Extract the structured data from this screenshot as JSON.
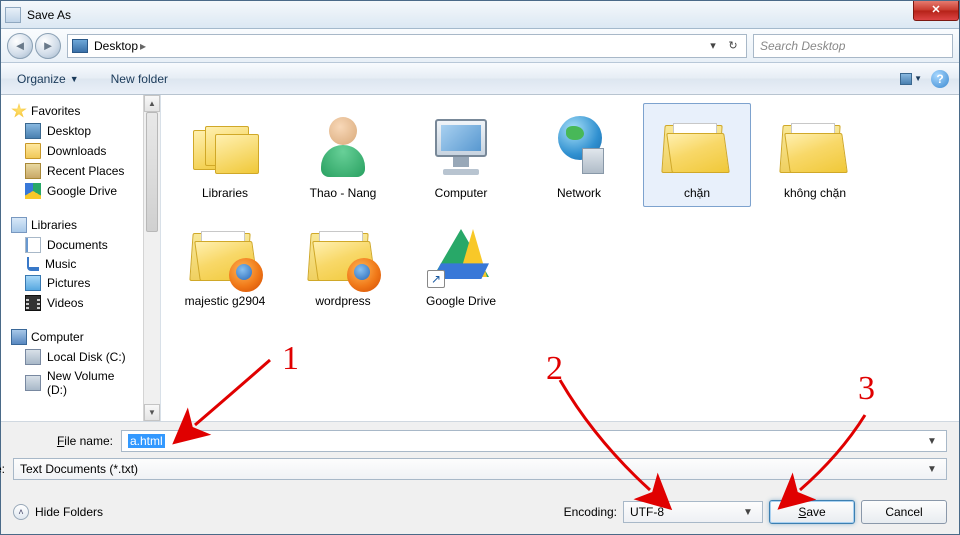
{
  "window": {
    "title": "Save As"
  },
  "addressbar": {
    "location": "Desktop",
    "search_placeholder": "Search Desktop"
  },
  "toolbar": {
    "organize": "Organize",
    "new_folder": "New folder"
  },
  "sidebar": {
    "favorites": {
      "header": "Favorites",
      "items": [
        "Desktop",
        "Downloads",
        "Recent Places",
        "Google Drive"
      ]
    },
    "libraries": {
      "header": "Libraries",
      "items": [
        "Documents",
        "Music",
        "Pictures",
        "Videos"
      ]
    },
    "computer": {
      "header": "Computer",
      "items": [
        "Local Disk (C:)",
        "New Volume (D:)"
      ]
    }
  },
  "items": [
    {
      "label": "Libraries",
      "kind": "libraries"
    },
    {
      "label": "Thao - Nang",
      "kind": "user"
    },
    {
      "label": "Computer",
      "kind": "computer"
    },
    {
      "label": "Network",
      "kind": "network"
    },
    {
      "label": "chặn",
      "kind": "folder",
      "selected": true
    },
    {
      "label": "không chặn",
      "kind": "folder"
    },
    {
      "label": "majestic g2904",
      "kind": "folder-firefox"
    },
    {
      "label": "wordpress",
      "kind": "folder-firefox"
    },
    {
      "label": "Google Drive",
      "kind": "gdrive-shortcut"
    }
  ],
  "fields": {
    "filename_label": "File name:",
    "filename_value": "a.html",
    "type_label": "Save as type:",
    "type_value": "Text Documents (*.txt)"
  },
  "footer": {
    "hide_folders": "Hide Folders",
    "encoding_label": "Encoding:",
    "encoding_value": "UTF-8",
    "save": "Save",
    "cancel": "Cancel"
  },
  "annotations": {
    "n1": "1",
    "n2": "2",
    "n3": "3"
  }
}
